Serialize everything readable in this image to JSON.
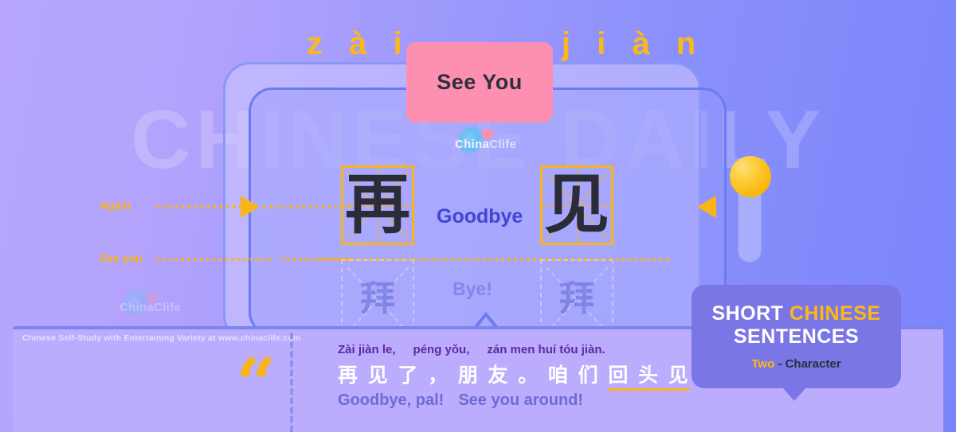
{
  "background": {
    "gradient_from": "#b7a6fc",
    "gradient_to": "#7b85fb",
    "watermark_text": "CHINESE DAILY"
  },
  "top": {
    "pinyin_left": "z à i",
    "pinyin_right": "j i à n",
    "badge_label": "See You",
    "badge_color": "#fd8fb0"
  },
  "brand": {
    "logo_text_a": "China",
    "logo_text_b": "Clife",
    "footer_note": "Chinese Self-Study with Entertaining Variety at www.chinaclife.com"
  },
  "guides": {
    "row_label_1": "Again",
    "row_label_2": "See you",
    "accent_color": "#f9b418"
  },
  "characters": {
    "primary": [
      {
        "han": "再",
        "gloss": "Again"
      },
      {
        "han": "见",
        "gloss": "See you"
      }
    ],
    "primary_gloss": "Goodbye",
    "ghost": [
      {
        "han": "拜"
      },
      {
        "han": "拜"
      }
    ],
    "ghost_gloss": "Bye!"
  },
  "sentence": {
    "pinyin_1": "Zài jiàn le,",
    "pinyin_2": "péng yǒu,",
    "pinyin_3": "zán men huí tóu jiàn.",
    "hanzi_plain_1": "再 见 了 ， 朋 友 。 咱 们 ",
    "hanzi_highlight": "回 头 见",
    "hanzi_plain_2": " 。",
    "english_1": "Goodbye, pal!",
    "english_2": "See you around!",
    "quote_glyph": "“"
  },
  "right_badge": {
    "line1_white": "SHORT ",
    "line1_accent": "CHINESE",
    "line2": "SENTENCES",
    "line3_accent": "Two",
    "line3_rest": " - Character",
    "bg_color": "#7b76e6"
  }
}
